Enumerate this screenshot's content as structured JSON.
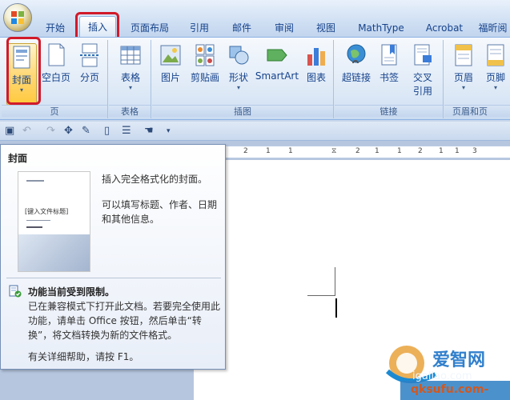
{
  "tabs": [
    "开始",
    "插入",
    "页面布局",
    "引用",
    "邮件",
    "审阅",
    "视图",
    "MathType",
    "Acrobat",
    "福昕阅"
  ],
  "ribbon": {
    "groups": [
      "页",
      "表格",
      "插图",
      "链接",
      "页眉和页"
    ],
    "buttons": {
      "cover": "封面",
      "blank": "空白页",
      "pagebreak": "分页",
      "table": "表格",
      "picture": "图片",
      "clipart": "剪贴画",
      "shapes": "形状",
      "smartart": "SmartArt",
      "chart": "图表",
      "hyperlink": "超链接",
      "bookmark": "书签",
      "crossref_1": "交叉",
      "crossref_2": "引用",
      "header": "页眉",
      "footer": "页脚"
    }
  },
  "ruler": [
    "2",
    "1",
    "1",
    "2",
    "1",
    "1",
    "2",
    "1",
    "1",
    "3"
  ],
  "tooltip": {
    "title": "封面",
    "thumb_title": "[键入文件标题]",
    "desc1": "插入完全格式化的封面。",
    "desc2": "可以填写标题、作者、日期和其他信息。",
    "warn_title": "功能当前受到限制。",
    "warn_body": "已在兼容模式下打开此文档。若要完全使用此功能，请单击 Office 按钮，然后单击“转换”，将文档转换为新的文件格式。",
    "help": "有关详细帮助，请按 F1。"
  },
  "watermark": {
    "line1": "爱智网",
    "line2": "igaliao.com",
    "line3": "qksufu.com-"
  },
  "colors": {
    "highlight": "#d11a2a",
    "ribbon_text": "#15428b"
  }
}
